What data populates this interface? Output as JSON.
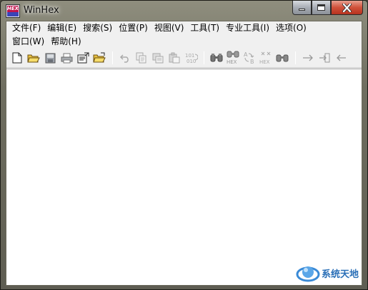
{
  "window": {
    "title": "WinHex",
    "logo_text": "HEX"
  },
  "menu": {
    "row1": [
      {
        "id": "file",
        "label": "文件(F)"
      },
      {
        "id": "edit",
        "label": "编辑(E)"
      },
      {
        "id": "search",
        "label": "搜索(S)"
      },
      {
        "id": "position",
        "label": "位置(P)"
      },
      {
        "id": "view",
        "label": "视图(V)"
      },
      {
        "id": "tools",
        "label": "工具(T)"
      },
      {
        "id": "pro-tools",
        "label": "专业工具(I)"
      },
      {
        "id": "options",
        "label": "选项(O)"
      }
    ],
    "row2": [
      {
        "id": "window",
        "label": "窗口(W)"
      },
      {
        "id": "help",
        "label": "帮助(H)"
      }
    ]
  },
  "toolbar": {
    "buttons": [
      {
        "icon": "new-file-icon"
      },
      {
        "icon": "open-folder-icon"
      },
      {
        "icon": "save-icon"
      },
      {
        "icon": "print-icon"
      },
      {
        "icon": "properties-icon"
      },
      {
        "icon": "open-directory-icon"
      },
      {
        "icon": "undo-icon"
      },
      {
        "icon": "copy-icon"
      },
      {
        "icon": "cut-icon"
      },
      {
        "icon": "paste-icon"
      },
      {
        "icon": "binary-icon"
      },
      {
        "icon": "find-text-icon"
      },
      {
        "icon": "find-hex-icon"
      },
      {
        "icon": "replace-text-icon"
      },
      {
        "icon": "replace-hex-icon"
      },
      {
        "icon": "find-next-icon"
      },
      {
        "icon": "goto-offset-icon"
      },
      {
        "icon": "goto-sector-icon"
      },
      {
        "icon": "back-icon"
      }
    ],
    "hex_label": "HEX",
    "binary_top": "101",
    "binary_bottom": "010",
    "ab_a": "A",
    "ab_b": "B"
  },
  "watermark": {
    "text": "系统天地"
  },
  "colors": {
    "accent": "#2a6fb7",
    "close_button": "#d0513a"
  }
}
